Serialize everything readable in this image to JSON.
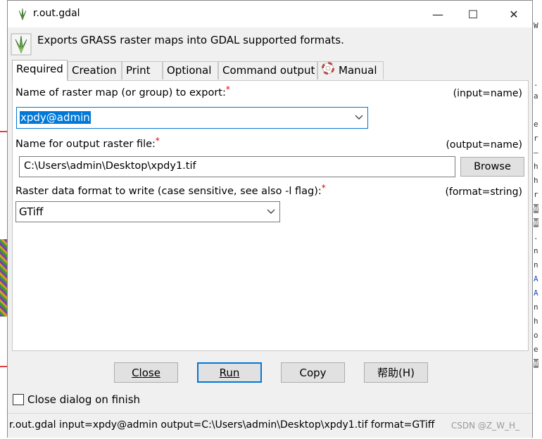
{
  "window": {
    "title": "r.out.gdal",
    "controls": {
      "minimize": "—",
      "maximize": "☐",
      "close": "✕"
    }
  },
  "header": {
    "description": "Exports GRASS raster maps into GDAL supported formats."
  },
  "tabs": [
    {
      "label": "Required",
      "active": true
    },
    {
      "label": "Creation"
    },
    {
      "label": "Print"
    },
    {
      "label": "Optional"
    },
    {
      "label": "Command output"
    },
    {
      "label": "Manual",
      "icon": "lifebuoy-icon"
    }
  ],
  "fields": {
    "input": {
      "label": "Name of raster map (or group) to export:",
      "required_mark": "*",
      "hint": "(input=name)",
      "value": "xpdy@admin"
    },
    "output": {
      "label": "Name for output raster file:",
      "required_mark": "*",
      "hint": "(output=name)",
      "value": "C:\\Users\\admin\\Desktop\\xpdy1.tif",
      "browse_label": "Browse"
    },
    "format": {
      "label": "Raster data format to write (case sensitive, see also -l flag):",
      "required_mark": "*",
      "hint": "(format=string)",
      "value": "GTiff"
    }
  },
  "buttons": {
    "close": "Close",
    "run": "Run",
    "copy": "Copy",
    "help": "帮助(H)"
  },
  "checkbox": {
    "label": "Close dialog on finish",
    "checked": false
  },
  "status": {
    "command": "r.out.gdal input=xpdy@admin output=C:\\Users\\admin\\Desktop\\xpdy1.tif format=GTiff",
    "watermark": "CSDN @Z_W_H_"
  },
  "background_chars": [
    ".",
    "a",
    "e",
    "r",
    "—",
    "h",
    "h",
    "r",
    "W",
    "W",
    ".",
    "n",
    "n",
    "A",
    "A",
    "n",
    "h",
    "o",
    "e",
    "W"
  ],
  "colors": {
    "accent": "#0078d7",
    "required": "#e00000",
    "window_bg": "#f0f0f0"
  }
}
